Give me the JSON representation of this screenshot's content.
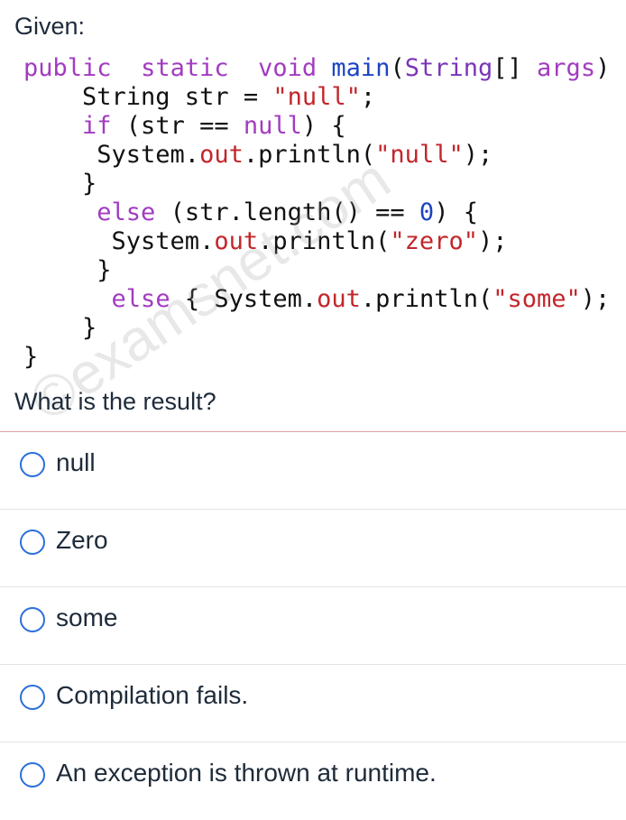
{
  "header": {
    "given": "Given:"
  },
  "code": {
    "lines": [
      [
        [
          "kw",
          "public"
        ],
        [
          "",
          "  "
        ],
        [
          "kw",
          "static"
        ],
        [
          "",
          "  "
        ],
        [
          "kw",
          "void"
        ],
        [
          "",
          " "
        ],
        [
          "fn",
          "main"
        ],
        [
          "",
          "("
        ],
        [
          "ty",
          "String"
        ],
        [
          "",
          "[] "
        ],
        [
          "kw",
          "args"
        ],
        [
          "",
          ") {"
        ]
      ],
      [
        [
          "",
          "    String str = "
        ],
        [
          "str",
          "\"null\""
        ],
        [
          "",
          ";"
        ]
      ],
      [
        [
          "",
          "    "
        ],
        [
          "kw",
          "if"
        ],
        [
          "",
          " (str == "
        ],
        [
          "kw",
          "null"
        ],
        [
          "",
          ") {"
        ]
      ],
      [
        [
          "",
          "     System."
        ],
        [
          "mem",
          "out"
        ],
        [
          "",
          ".println("
        ],
        [
          "str",
          "\"null\""
        ],
        [
          "",
          ");"
        ]
      ],
      [
        [
          "",
          "    }"
        ]
      ],
      [
        [
          "",
          "     "
        ],
        [
          "kw",
          "else"
        ],
        [
          "",
          " (str.length() == "
        ],
        [
          "num",
          "0"
        ],
        [
          "",
          ") {"
        ]
      ],
      [
        [
          "",
          "      System."
        ],
        [
          "mem",
          "out"
        ],
        [
          "",
          ".println("
        ],
        [
          "str",
          "\"zero\""
        ],
        [
          "",
          ");"
        ]
      ],
      [
        [
          "",
          "     }"
        ]
      ],
      [
        [
          "",
          "      "
        ],
        [
          "kw",
          "else"
        ],
        [
          "",
          " { System."
        ],
        [
          "mem",
          "out"
        ],
        [
          "",
          ".println("
        ],
        [
          "str",
          "\"some\""
        ],
        [
          "",
          ");"
        ]
      ],
      [
        [
          "",
          "    }"
        ]
      ],
      [
        [
          "",
          "}"
        ]
      ]
    ]
  },
  "question": "What is the result?",
  "watermark": "©examsnet.com",
  "options": [
    {
      "label": "null"
    },
    {
      "label": "Zero"
    },
    {
      "label": "some"
    },
    {
      "label": "Compilation fails."
    },
    {
      "label": "An exception is thrown at runtime."
    }
  ],
  "colors": {
    "keyword": "#a23bc0",
    "function": "#1d44c4",
    "string": "#c2262b",
    "radio_border": "#2a6fdb"
  }
}
